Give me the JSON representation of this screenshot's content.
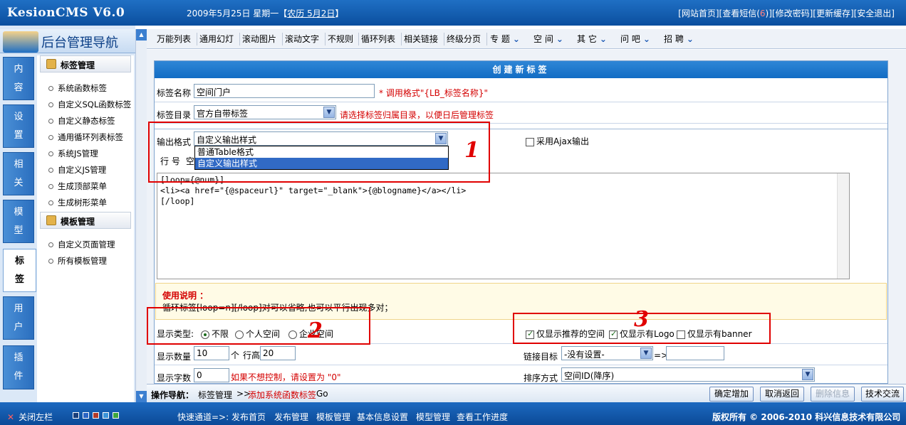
{
  "header": {
    "logo": "KesionCMS V6.0",
    "date": "2009年5月25日 星期一【",
    "lunar": "农历 5月2日",
    "date_end": "】",
    "links_before_badge": "[网站首页][查看短信(",
    "badge": "6",
    "links_after_badge": ")][修改密码][更新缓存][安全退出]"
  },
  "sidebar": {
    "title": "后台管理导航",
    "tabs": [
      {
        "label": "内\n容"
      },
      {
        "label": "设\n置"
      },
      {
        "label": "相\n关"
      },
      {
        "label": "模\n型"
      },
      {
        "label": "标\n签"
      },
      {
        "label": "用\n户"
      },
      {
        "label": "插\n件"
      }
    ],
    "group1": "标签管理",
    "group1_items": [
      "系统函数标签",
      "自定义SQL函数标签",
      "自定义静态标签",
      "通用循环列表标签",
      "系统JS管理",
      "自定义JS管理",
      "生成顶部菜单",
      "生成树形菜单"
    ],
    "group2": "模板管理",
    "group2_items": [
      "自定义页面管理",
      "所有模板管理"
    ]
  },
  "toptabs": [
    "万能列表",
    "通用幻灯",
    "滚动图片",
    "滚动文字",
    "不规则",
    "循环列表",
    "相关链接",
    "终级分页",
    "专 题",
    "空 间",
    "其 它",
    "问 吧",
    "招 聘"
  ],
  "form": {
    "header": "创建新标签",
    "name_label": "标签名称",
    "name_value": "空间门户",
    "name_hint": "* 调用格式\"{LB_标签名称}\"",
    "dir_label": "标签目录",
    "dir_value": "官方自带标签",
    "dir_hint": "请选择标签归属目录，以便日后管理标签",
    "output_label": "输出格式",
    "output_value": "自定义输出样式",
    "output_options": [
      "普通Table格式",
      "自定义输出样式"
    ],
    "ajax_label": "采用Ajax输出",
    "row_label": "行 号",
    "row_trail": "空",
    "code_lines": "[loop={@num}]\n<li><a href=\"{@spaceurl}\" target=\"_blank\">{@blogname}</a></li>\n[/loop]",
    "usage_title": "使用说明 ：",
    "usage_text": "循环标签[loop=n][/loop]对可以省略,也可以平行出现多对；",
    "type_label": "显示类型:",
    "type_options": [
      "不限",
      "个人空间",
      "企业空间"
    ],
    "check_options": [
      "仅显示推荐的空间",
      "仅显示有Logo",
      "仅显示有banner"
    ],
    "count_label": "显示数量",
    "count_value": "10",
    "count_unit": "个",
    "row_height_label": "行高",
    "row_height_value": "20",
    "link_target_label": "链接目标",
    "link_target_value": "-没有设置-",
    "link_arrow": "=>",
    "chars_label": "显示字数",
    "chars_value": "0",
    "chars_hint": "如果不想控制，请设置为 \"0\"",
    "sort_label": "排序方式",
    "sort_value": "空间ID(降序)"
  },
  "annotations": [
    "1",
    "2",
    "3"
  ],
  "crumb": {
    "label": "操作导航：",
    "path": "标签管理",
    "arrow": ">>",
    "current": "添加系统函数标签",
    "go": "Go"
  },
  "buttons": [
    "确定增加",
    "取消返回",
    "删除信息",
    "技术交流"
  ],
  "footer": {
    "close": "关闭左栏",
    "quick": "快速通道=>:",
    "links": [
      "发布首页",
      "发布管理",
      "模板管理",
      "基本信息设置",
      "模型管理",
      "查看工作进度"
    ],
    "copyright": "版权所有 © 2006-2010 科兴信息技术有限公司"
  },
  "colors": {
    "accent": "#1265c2",
    "annotation": "#e00000",
    "hint": "#d40000"
  }
}
